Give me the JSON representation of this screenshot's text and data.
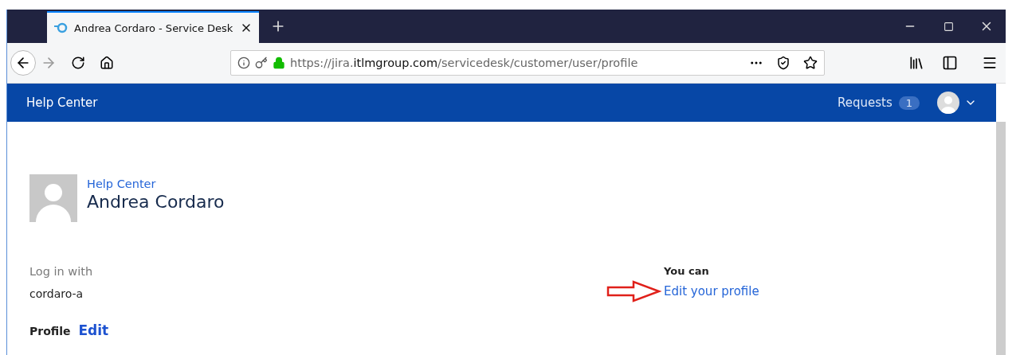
{
  "browser": {
    "tab": {
      "title": "Andrea Cordaro - Service Desk",
      "selected": true
    },
    "url": "https://jira.**itlmgroup.com**/servicedesk/customer/user/profile"
  },
  "header": {
    "brand": "Help Center",
    "requests": {
      "label": "Requests",
      "count": "1"
    }
  },
  "profile": {
    "breadcrumb": "Help Center",
    "name": "Andrea Cordaro",
    "login_label": "Log in with",
    "login_value": "cordaro-a",
    "section_title": "Profile",
    "edit_link": "Edit",
    "side_label": "You can",
    "side_link": "Edit your profile"
  }
}
